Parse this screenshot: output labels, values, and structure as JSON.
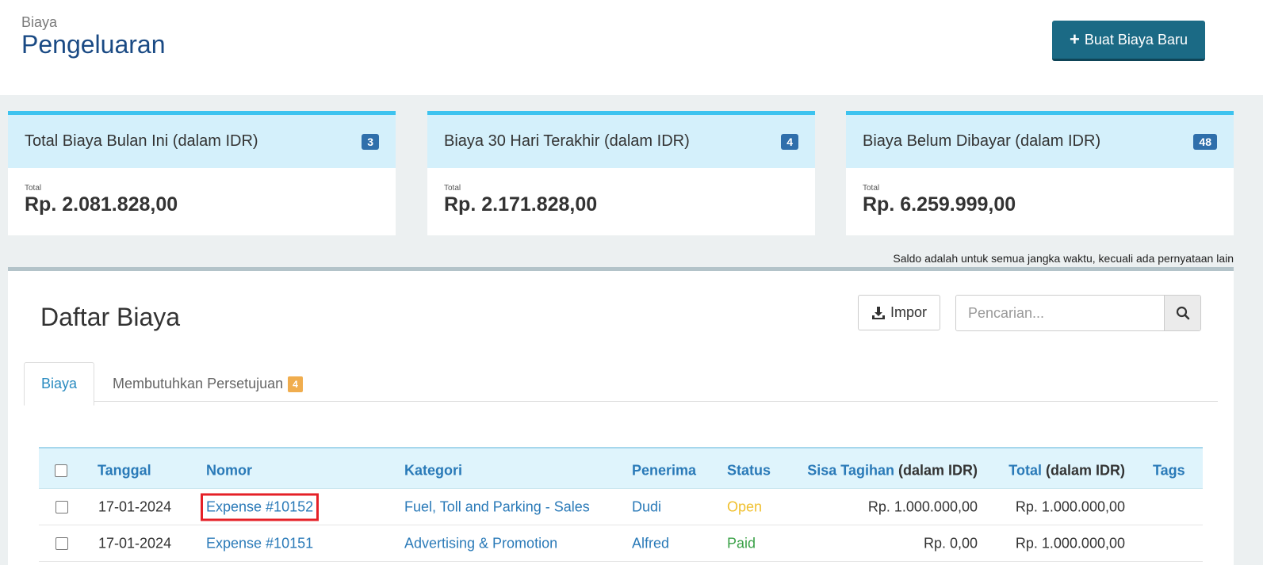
{
  "header": {
    "breadcrumb": "Biaya",
    "title": "Pengeluaran",
    "new_button_label": "Buat Biaya Baru"
  },
  "cards": [
    {
      "title": "Total Biaya Bulan Ini (dalam IDR)",
      "badge": "3",
      "label": "Total",
      "value": "Rp. 2.081.828,00"
    },
    {
      "title": "Biaya 30 Hari Terakhir (dalam IDR)",
      "badge": "4",
      "label": "Total",
      "value": "Rp. 2.171.828,00"
    },
    {
      "title": "Biaya Belum Dibayar (dalam IDR)",
      "badge": "48",
      "label": "Total",
      "value": "Rp. 6.259.999,00"
    }
  ],
  "balance_note": "Saldo adalah untuk semua jangka waktu, kecuali ada pernyataan lain",
  "list": {
    "title": "Daftar Biaya",
    "import_label": "Impor",
    "search_placeholder": "Pencarian...",
    "tabs": [
      {
        "label": "Biaya",
        "active": true
      },
      {
        "label": "Membutuhkan Persetujuan",
        "badge": "4"
      }
    ],
    "columns": {
      "tanggal": "Tanggal",
      "nomor": "Nomor",
      "kategori": "Kategori",
      "penerima": "Penerima",
      "status": "Status",
      "sisa": "Sisa Tagihan",
      "sisa_suffix": "(dalam IDR)",
      "total": "Total",
      "total_suffix": "(dalam IDR)",
      "tags": "Tags"
    },
    "rows": [
      {
        "tanggal": "17-01-2024",
        "nomor": "Expense #10152",
        "kategori": "Fuel, Toll and Parking - Sales",
        "penerima": "Dudi",
        "status": "Open",
        "sisa": "Rp. 1.000.000,00",
        "total": "Rp. 1.000.000,00"
      },
      {
        "tanggal": "17-01-2024",
        "nomor": "Expense #10151",
        "kategori": "Advertising & Promotion",
        "penerima": "Alfred",
        "status": "Paid",
        "sisa": "Rp. 0,00",
        "total": "Rp. 1.000.000,00"
      }
    ]
  },
  "colors": {
    "brand_title": "#1a4a84",
    "primary_button": "#1b6a85",
    "card_header": "#d4f0fb",
    "link": "#2a7ab8",
    "status_open": "#f0c02e",
    "status_paid": "#3aa147",
    "highlight_box": "#e52027"
  }
}
